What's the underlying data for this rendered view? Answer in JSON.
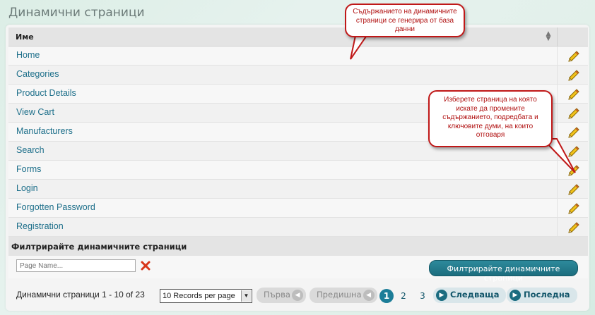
{
  "header": {
    "title": "Динамични страници"
  },
  "grid": {
    "column_name": "Име",
    "rows": [
      {
        "name": "Home"
      },
      {
        "name": "Categories"
      },
      {
        "name": "Product Details"
      },
      {
        "name": "View Cart"
      },
      {
        "name": "Manufacturers"
      },
      {
        "name": "Search"
      },
      {
        "name": "Forms"
      },
      {
        "name": "Login"
      },
      {
        "name": "Forgotten Password"
      },
      {
        "name": "Registration"
      }
    ]
  },
  "filter": {
    "header": "Филтрирайте динамичните страници",
    "placeholder": "Page Name...",
    "button_label": "Филтрирайте динамичните страници"
  },
  "pager": {
    "info": "Динамични страници 1 - 10 of 23",
    "page_size": "10 Records per page",
    "first_label": "Първа",
    "prev_label": "Предишна",
    "pages": [
      "1",
      "2",
      "3"
    ],
    "current_page": "1",
    "next_label": "Следваща",
    "last_label": "Последна"
  },
  "callouts": {
    "top": "Съдържанието на динамичните страници се генерира от база данни",
    "right": "Изберете страница на която искате да промените съдържанието, подредбата и ключовите думи, на които отговаря"
  },
  "colors": {
    "link": "#1d6f8a",
    "accent": "#1c7d98",
    "callout_border": "#c01818",
    "callout_text": "#b01010"
  },
  "icons": {
    "edit": "pencil-icon",
    "clear": "x-icon",
    "sort": "sort-arrows-icon"
  }
}
